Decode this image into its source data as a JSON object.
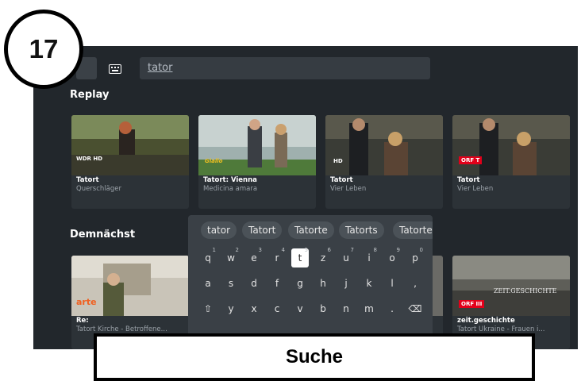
{
  "step": {
    "number": "17",
    "caption": "Suche"
  },
  "search": {
    "value": "tator",
    "keyboard_icon": "keyboard-icon",
    "mic_icon": "mic-icon"
  },
  "sections": {
    "replay": {
      "title": "Replay"
    },
    "upcoming": {
      "title": "Demnächst"
    }
  },
  "replay_items": [
    {
      "title": "Tatort",
      "subtitle": "Querschläger",
      "channel": "WDR HD"
    },
    {
      "title": "Tatort: Vienna",
      "subtitle": "Medicina amara",
      "channel": "Giallo"
    },
    {
      "title": "Tatort",
      "subtitle": "Vier Leben",
      "channel": "HD"
    },
    {
      "title": "Tatort",
      "subtitle": "Vier Leben",
      "channel": "ORF T"
    }
  ],
  "upcoming_items": [
    {
      "title": "Re:",
      "subtitle": "Tatort Kirche - Betroffene...",
      "channel": "arte"
    },
    {
      "title": "zeit.geschichte",
      "subtitle": "Tatort Ukraine - Frauen i...",
      "channel": "ORF III",
      "thumb_text": "ZEIT.GESCHICHTE"
    }
  ],
  "keyboard": {
    "suggestions": [
      "tator",
      "Tatort",
      "Tatorte",
      "Tatorts",
      "Tatorte"
    ],
    "row1": [
      [
        "q",
        "1"
      ],
      [
        "w",
        "2"
      ],
      [
        "e",
        "3"
      ],
      [
        "r",
        "4"
      ],
      [
        "t",
        "5"
      ],
      [
        "z",
        "6"
      ],
      [
        "u",
        "7"
      ],
      [
        "i",
        "8"
      ],
      [
        "o",
        "9"
      ],
      [
        "p",
        "0"
      ]
    ],
    "row2": [
      "a",
      "s",
      "d",
      "f",
      "g",
      "h",
      "j",
      "k",
      "l",
      ","
    ],
    "row3": [
      "⇧",
      "y",
      "x",
      "c",
      "v",
      "b",
      "n",
      "m",
      ".",
      "⌫"
    ],
    "active_key": "t"
  },
  "colors": {
    "bg": "#22272c",
    "card": "#2c3237",
    "keyboard": "#3a4046",
    "accent_red": "#e2001a"
  }
}
